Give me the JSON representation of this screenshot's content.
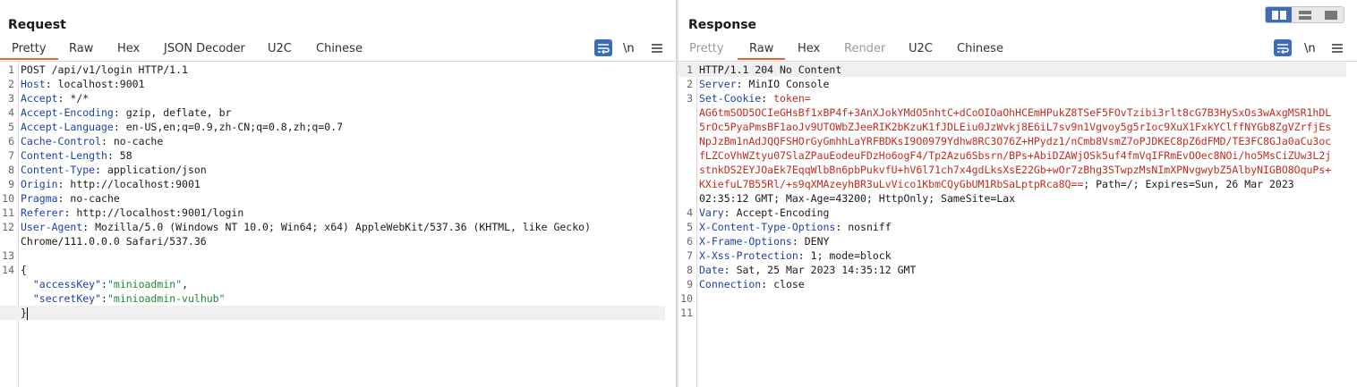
{
  "request": {
    "title": "Request",
    "tabs": [
      {
        "label": "Pretty",
        "active": true
      },
      {
        "label": "Raw"
      },
      {
        "label": "Hex"
      },
      {
        "label": "JSON Decoder"
      },
      {
        "label": "U2C"
      },
      {
        "label": "Chinese"
      }
    ],
    "newline_label": "\\n",
    "lines": [
      {
        "n": "1",
        "text": "POST /api/v1/login HTTP/1.1"
      },
      {
        "n": "2",
        "name": "Host",
        "value": " localhost:9001"
      },
      {
        "n": "3",
        "name": "Accept",
        "value": " */*"
      },
      {
        "n": "4",
        "name": "Accept-Encoding",
        "value": " gzip, deflate, br"
      },
      {
        "n": "5",
        "name": "Accept-Language",
        "value": " en-US,en;q=0.9,zh-CN;q=0.8,zh;q=0.7"
      },
      {
        "n": "6",
        "name": "Cache-Control",
        "value": " no-cache"
      },
      {
        "n": "7",
        "name": "Content-Length",
        "value": " 58"
      },
      {
        "n": "8",
        "name": "Content-Type",
        "value": " application/json"
      },
      {
        "n": "9",
        "name": "Origin",
        "value": " http://localhost:9001"
      },
      {
        "n": "10",
        "name": "Pragma",
        "value": " no-cache"
      },
      {
        "n": "11",
        "name": "Referer",
        "value": " http://localhost:9001/login"
      },
      {
        "n": "12",
        "name": "User-Agent",
        "value": " Mozilla/5.0 (Windows NT 10.0; Win64; x64) AppleWebKit/537.36 (KHTML, like Gecko)"
      },
      {
        "n": "",
        "text": "Chrome/111.0.0.0 Safari/537.36"
      },
      {
        "n": "13",
        "text": ""
      },
      {
        "n": "14",
        "text": "{"
      },
      {
        "n": "",
        "text": "  ",
        "key": "\"accessKey\"",
        "sep": ":",
        "val": "\"minioadmin\"",
        "tail": ","
      },
      {
        "n": "",
        "text": "  ",
        "key": "\"secretKey\"",
        "sep": ":",
        "val": "\"minioadmin-vulhub\"",
        "tail": ""
      },
      {
        "n": "",
        "text": "}",
        "highlight": true,
        "cursor": true
      }
    ]
  },
  "response": {
    "title": "Response",
    "tabs": [
      {
        "label": "Pretty",
        "disabled": true
      },
      {
        "label": "Raw",
        "active": true
      },
      {
        "label": "Hex"
      },
      {
        "label": "Render",
        "disabled": true
      },
      {
        "label": "U2C"
      },
      {
        "label": "Chinese"
      }
    ],
    "newline_label": "\\n",
    "lines": [
      {
        "n": "1",
        "text": "HTTP/1.1 204 No Content",
        "highlight": true
      },
      {
        "n": "2",
        "name": "Server",
        "value": " MinIO Console"
      },
      {
        "n": "3",
        "name": "Set-Cookie",
        "value": " ",
        "cookie": "token="
      },
      {
        "n": "",
        "cookie": "AG6tmSOD5OCIeGHsBf1xBP4f+3AnXJokYMdO5nhtC+dCoOIOaOhHCEmHPukZ8TSeF5FOvTzibi3rlt8cG7B3HySxOs3wAxgMSR1hDL"
      },
      {
        "n": "",
        "cookie": "5rOc5PyaPmsBF1aoJv9UTOWbZJeeRIK2bKzuK1fJDLEiu0JzWvkj8E6iL7sv9n1Vgvoy5g5rIoc9XuX1FxkYClffNYGb8ZgVZrfjEs"
      },
      {
        "n": "",
        "cookie": "NpJzBm1nAdJQQFSHOrGyGmhhLaYRFBDKsI9O0979Ydhw8RC3O76Z+HPydz1/nCmb8VsmZ7oPJDKEC8pZ6dFMD/TE3FC8GJa0aCu3oc"
      },
      {
        "n": "",
        "cookie": "fLZCoVhWZtyu07SlaZPauEodeuFDzHo6ogF4/Tp2Azu6Sbsrn/BPs+AbiDZAWjOSk5uf4fmVqIFRmEvOOec8NOi/ho5MsCiZUw3L2j"
      },
      {
        "n": "",
        "cookie": "stnkDS2EYJOaEk7EqqWlbBn6pbPukvfU+hV6l71ch7x4gdLksXsE22Gb+wOr7zBhg3STwpzMsNImXPNvgwybZ5AlbyNIGBO8OquPs+"
      },
      {
        "n": "",
        "cookie": "KXiefuL7B55Rl/+s9qXMAzeyhBR3uLvVico1KbmCQyGbUM1RbSaLptpRca8Q==",
        "value2": "; Path=/; Expires=Sun, 26 Mar 2023"
      },
      {
        "n": "",
        "text": "02:35:12 GMT; Max-Age=43200; HttpOnly; SameSite=Lax"
      },
      {
        "n": "4",
        "name": "Vary",
        "value": " Accept-Encoding"
      },
      {
        "n": "5",
        "name": "X-Content-Type-Options",
        "value": " nosniff"
      },
      {
        "n": "6",
        "name": "X-Frame-Options",
        "value": " DENY"
      },
      {
        "n": "7",
        "name": "X-Xss-Protection",
        "value": " 1; mode=block"
      },
      {
        "n": "8",
        "name": "Date",
        "value": " Sat, 25 Mar 2023 14:35:12 GMT"
      },
      {
        "n": "9",
        "name": "Connection",
        "value": " close"
      },
      {
        "n": "10",
        "text": ""
      },
      {
        "n": "11",
        "text": ""
      }
    ]
  },
  "layout_buttons": [
    {
      "name": "side-by-side-layout-icon",
      "active": true
    },
    {
      "name": "top-bottom-layout-icon",
      "active": false
    },
    {
      "name": "tabs-layout-icon",
      "active": false
    }
  ],
  "colors": {
    "accent": "#e8642b",
    "tool_blue": "#3c6db5",
    "header_name": "#1c3fab",
    "cookie": "#c42b1c",
    "json_value": "#1d8a33"
  }
}
